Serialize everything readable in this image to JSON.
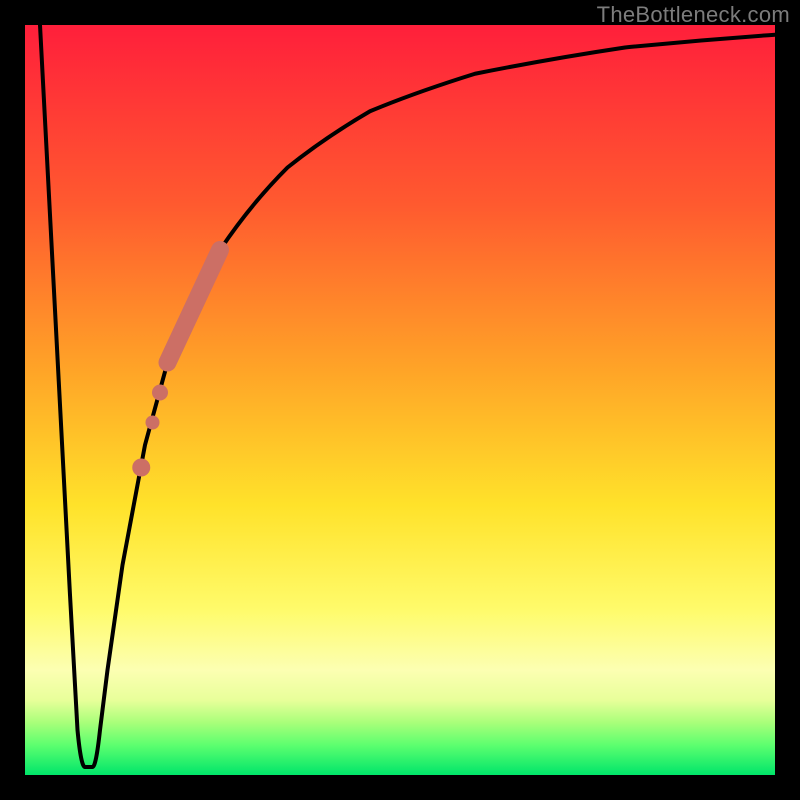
{
  "watermark": "TheBottleneck.com",
  "colors": {
    "frame": "#000000",
    "curve_stroke": "#000000",
    "marker_fill": "#cc6f65",
    "gradient_top": "#ff1f3b",
    "gradient_bottom": "#00e56a"
  },
  "chart_data": {
    "type": "line",
    "title": "",
    "xlabel": "",
    "ylabel": "",
    "xlim": [
      0,
      100
    ],
    "ylim": [
      0,
      100
    ],
    "grid": false,
    "legend": false,
    "series": [
      {
        "name": "bottleneck-curve",
        "x": [
          2,
          4,
          6,
          7,
          8,
          9,
          10,
          11,
          13,
          16,
          19,
          22,
          26,
          30,
          35,
          40,
          46,
          52,
          60,
          70,
          80,
          90,
          100
        ],
        "y": [
          100,
          62,
          24,
          6,
          1,
          1,
          6,
          14,
          28,
          44,
          55,
          63,
          70,
          76,
          81,
          85,
          88.5,
          91,
          93.5,
          95.5,
          97,
          98,
          98.7
        ]
      }
    ],
    "markers": [
      {
        "name": "highlight-segment",
        "shape": "thick-line",
        "color": "#cc6f65",
        "x": [
          19,
          26
        ],
        "y": [
          55,
          70
        ]
      },
      {
        "name": "dot-1",
        "shape": "circle",
        "color": "#cc6f65",
        "x": 18.0,
        "y": 51
      },
      {
        "name": "dot-2",
        "shape": "circle",
        "color": "#cc6f65",
        "x": 17.0,
        "y": 47
      },
      {
        "name": "dot-3",
        "shape": "circle",
        "color": "#cc6f65",
        "x": 15.5,
        "y": 41
      }
    ]
  }
}
